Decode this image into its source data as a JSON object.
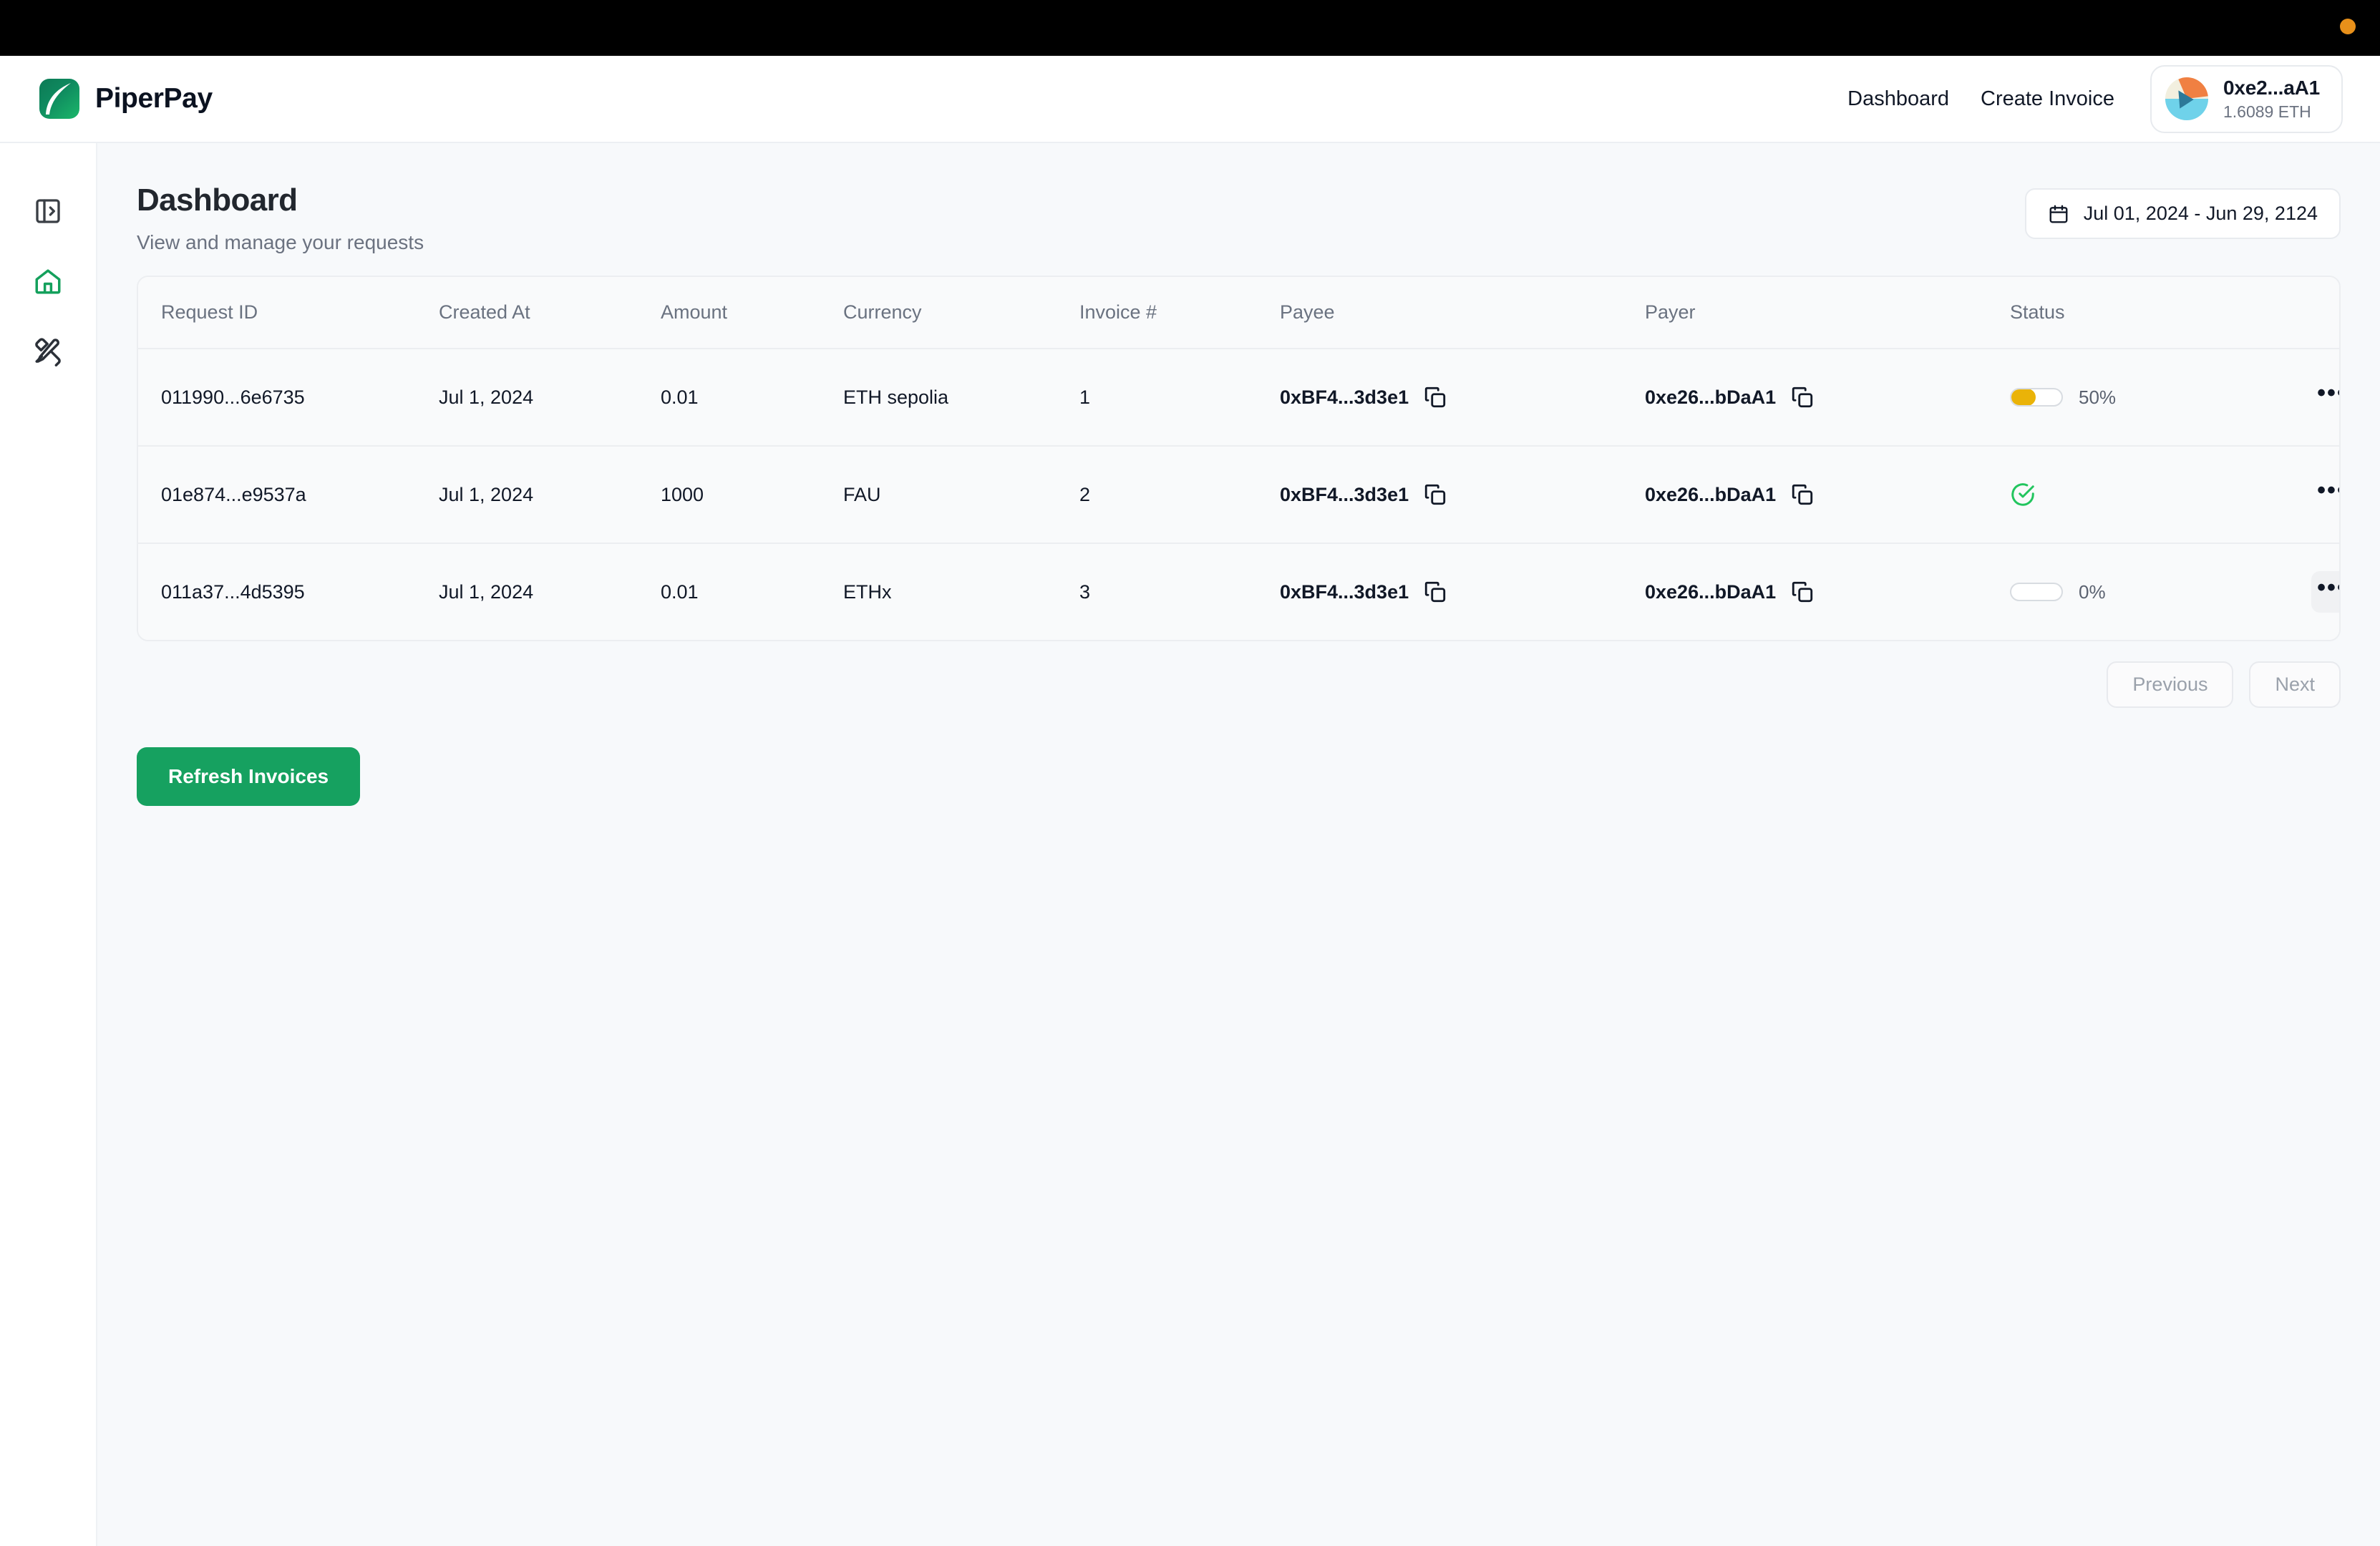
{
  "topbar": {
    "dot_color": "#e8901a"
  },
  "header": {
    "brand_name": "PiperPay",
    "logo_icon": "piperpay-leaf-logo",
    "nav": [
      {
        "label": "Dashboard"
      },
      {
        "label": "Create Invoice"
      }
    ],
    "wallet": {
      "address": "0xe2...aA1",
      "balance": "1.6089 ETH",
      "avatar_icon": "wallet-blockie-avatar"
    }
  },
  "sidebar": {
    "items": [
      {
        "icon": "panel-expand-icon",
        "active": false
      },
      {
        "icon": "home-icon",
        "active": true
      },
      {
        "icon": "pen-ruler-icon",
        "active": false
      }
    ],
    "active_color": "#14a05c"
  },
  "page": {
    "title": "Dashboard",
    "subtitle": "View and manage your requests",
    "date_range": "Jul 01, 2024 - Jun 29, 2124",
    "calendar_icon": "calendar-icon"
  },
  "table": {
    "columns": [
      "Request ID",
      "Created At",
      "Amount",
      "Currency",
      "Invoice #",
      "Payee",
      "Payer",
      "Status",
      ""
    ],
    "rows": [
      {
        "request_id": "011990...6e6735",
        "created_at": "Jul 1, 2024",
        "amount": "0.01",
        "currency": "ETH sepolia",
        "invoice_no": "1",
        "payee": "0xBF4...3d3e1",
        "payer": "0xe26...bDaA1",
        "status_type": "progress",
        "progress_pct": 50,
        "progress_label": "50%",
        "menu_hover": false
      },
      {
        "request_id": "01e874...e9537a",
        "created_at": "Jul 1, 2024",
        "amount": "1000",
        "currency": "FAU",
        "invoice_no": "2",
        "payee": "0xBF4...3d3e1",
        "payer": "0xe26...bDaA1",
        "status_type": "paid",
        "progress_pct": 100,
        "progress_label": "",
        "menu_hover": false
      },
      {
        "request_id": "011a37...4d5395",
        "created_at": "Jul 1, 2024",
        "amount": "0.01",
        "currency": "ETHx",
        "invoice_no": "3",
        "payee": "0xBF4...3d3e1",
        "payer": "0xe26...bDaA1",
        "status_type": "progress",
        "progress_pct": 0,
        "progress_label": "0%",
        "menu_hover": true
      }
    ],
    "copy_icon": "copy-icon",
    "menu_icon": "more-horizontal-icon",
    "paid_icon": "circle-check-icon",
    "progress_color": "#eab308",
    "paid_color": "#22c55e"
  },
  "pagination": {
    "previous_label": "Previous",
    "next_label": "Next"
  },
  "actions": {
    "refresh_label": "Refresh Invoices",
    "refresh_color": "#16a160"
  }
}
